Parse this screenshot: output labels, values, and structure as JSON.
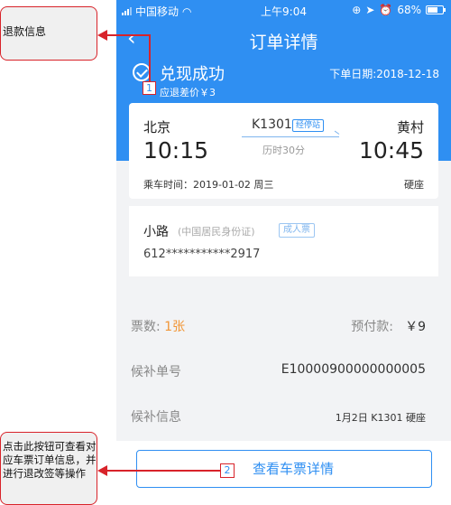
{
  "status_bar": {
    "carrier": "中国移动",
    "time": "上午9:04",
    "battery": "68%",
    "battery_level": 0.68
  },
  "nav": {
    "back_icon": "chevron-left-icon",
    "title": "订单详情"
  },
  "order_status": {
    "title": "兑现成功",
    "order_date": "下单日期:2018-12-18",
    "refund_diff": "应退差价￥3"
  },
  "trip": {
    "from_station": "北京",
    "to_station": "黄村",
    "depart_time": "10:15",
    "arrive_time": "10:45",
    "train_no": "K1301",
    "via_label": "经停站",
    "duration": "历时30分",
    "ride_time": "乘车时间：2019-01-02 周三",
    "seat_type": "硬座"
  },
  "passenger": {
    "name": "小路",
    "id_type": "(中国居民身份证)",
    "ticket_type": "成人票",
    "id_number": "612***********2917"
  },
  "summary": {
    "ticket_count_label": "票数:",
    "ticket_count": "1张",
    "prepay_label": "预付款:",
    "prepay_value": "￥9",
    "waitlist_no_label": "候补单号",
    "waitlist_no": "E10000900000000005",
    "waitlist_info_label": "候补信息",
    "waitlist_info": "1月2日 K1301 硬座"
  },
  "actions": {
    "view_ticket_details": "查看车票详情"
  },
  "annotations": {
    "callout1": "退款信息",
    "callout2": "点击此按钮可查看对应车票订单信息，并进行退改签等操作",
    "marker1": "1",
    "marker2": "2"
  },
  "colors": {
    "header_blue": "#2f8ff2",
    "accent_orange": "#f19535",
    "annotation_red": "#d8232a"
  }
}
